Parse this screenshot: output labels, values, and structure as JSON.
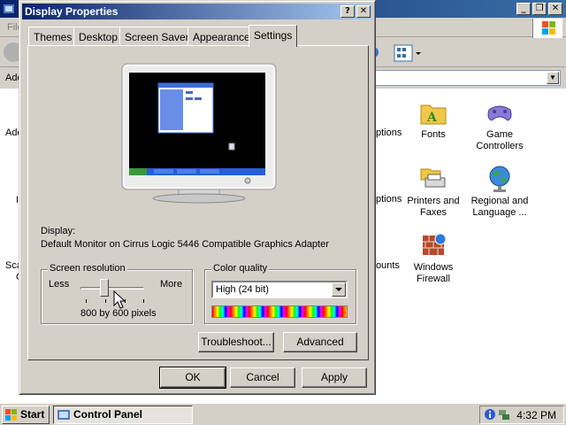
{
  "background_window": {
    "menu_file": "File",
    "address_label": "Address",
    "cut_labels": {
      "add_left": "Add",
      "i_left": "I",
      "scan_left": "Scan",
      "scan_left2": "C",
      "options_1": "ptions",
      "options_2": "ptions",
      "accounts": "ounts"
    },
    "items": [
      {
        "name": "Fonts",
        "icon": "fonts-folder-icon"
      },
      {
        "name": "Game Controllers",
        "icon": "game-controller-icon"
      },
      {
        "name": "Printers and Faxes",
        "icon": "printer-icon"
      },
      {
        "name": "Regional and Language ...",
        "icon": "globe-icon"
      },
      {
        "name": "Windows Firewall",
        "icon": "firewall-icon"
      }
    ]
  },
  "dialog": {
    "title": "Display Properties",
    "tabs": [
      "Themes",
      "Desktop",
      "Screen Saver",
      "Appearance",
      "Settings"
    ],
    "active_tab": "Settings",
    "display_label": "Display:",
    "display_value": "Default Monitor on Cirrus Logic 5446 Compatible Graphics Adapter",
    "resolution": {
      "legend": "Screen resolution",
      "less": "Less",
      "more": "More",
      "value": "800 by 600 pixels",
      "slider_position": 0.33
    },
    "color_quality": {
      "legend": "Color quality",
      "selected": "High (24 bit)"
    },
    "buttons": {
      "troubleshoot": "Troubleshoot...",
      "advanced": "Advanced",
      "ok": "OK",
      "cancel": "Cancel",
      "apply": "Apply"
    }
  },
  "taskbar": {
    "start": "Start",
    "task": "Control Panel",
    "time": "4:32 PM"
  },
  "colors": {
    "title_active": "#0a246a",
    "face": "#d4d0c8",
    "xp_blue": "#245edb"
  }
}
